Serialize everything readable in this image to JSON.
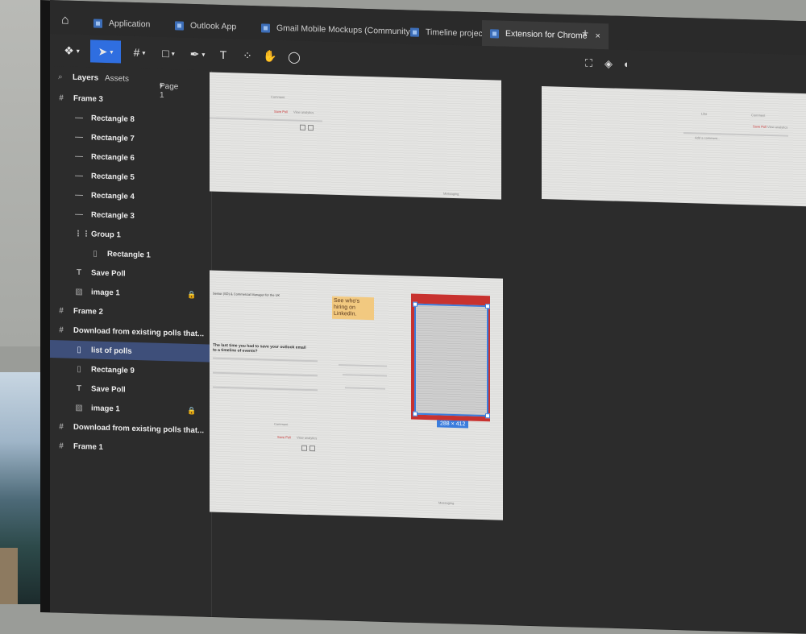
{
  "tabs": [
    {
      "label": "Application"
    },
    {
      "label": "Outlook App"
    },
    {
      "label": "Gmail Mobile Mockups (Community)"
    },
    {
      "label": "Timeline project"
    },
    {
      "label": "Extension for Chrome",
      "active": true
    }
  ],
  "tab_close": "×",
  "tab_add": "+",
  "panel": {
    "layers_tab": "Layers",
    "assets_tab": "Assets",
    "page_selector": "Page 1",
    "layers": [
      {
        "label": "Frame 3",
        "icon": "frame-icon"
      },
      {
        "label": "Rectangle 8",
        "icon": "line-icon"
      },
      {
        "label": "Rectangle 7",
        "icon": "line-icon"
      },
      {
        "label": "Rectangle 6",
        "icon": "line-icon"
      },
      {
        "label": "Rectangle 5",
        "icon": "line-icon"
      },
      {
        "label": "Rectangle 4",
        "icon": "line-icon"
      },
      {
        "label": "Rectangle 3",
        "icon": "line-icon"
      },
      {
        "label": "Group 1",
        "icon": "group-icon"
      },
      {
        "label": "Rectangle 1",
        "icon": "rectangle-icon"
      },
      {
        "label": "Save Poll",
        "icon": "text-icon"
      },
      {
        "label": "image 1",
        "icon": "image-icon",
        "locked": true
      },
      {
        "label": "Frame 2",
        "icon": "frame-icon"
      },
      {
        "label": "Download from existing polls that...",
        "icon": "frame-icon"
      },
      {
        "label": "list of polls",
        "icon": "rectangle-icon",
        "selected": true
      },
      {
        "label": "Rectangle 9",
        "icon": "rectangle-icon"
      },
      {
        "label": "Save Poll",
        "icon": "text-icon"
      },
      {
        "label": "image 1",
        "icon": "image-icon",
        "locked": true
      },
      {
        "label": "Download from existing polls that...",
        "icon": "frame-icon"
      },
      {
        "label": "Frame 1",
        "icon": "frame-icon"
      }
    ]
  },
  "canvas": {
    "ad_headline": "See who's hiring on LinkedIn.",
    "selection_size": "288 × 412",
    "mock_text": {
      "save_poll": "Save Poll",
      "view_analytics": "View analytics",
      "messaging": "Messaging",
      "comment": "Comment",
      "like": "Like",
      "write_comment": "Add a comment...",
      "question": "The last time you had to save your outlook email to a timeline of events?",
      "job_line": "Senior (SD) & Commercial Manager for the UK"
    }
  },
  "colors": {
    "accent": "#2f6ee0",
    "selected_layer": "#3e4f7a",
    "selection_frame": "#c8322f",
    "canvas_bg": "#2c2c2c"
  }
}
